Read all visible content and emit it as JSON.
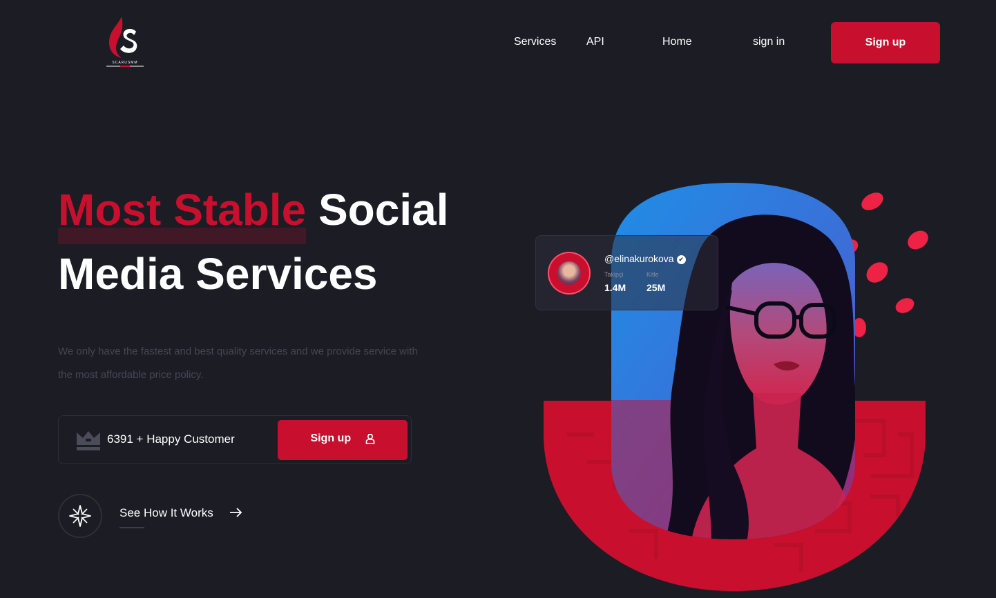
{
  "brand": {
    "logo_text": "SCARUSMM",
    "logo_icon": "flame-s-logo",
    "accent": "#c8102e",
    "background": "#1b1c24"
  },
  "nav": {
    "items": [
      {
        "label": "Services"
      },
      {
        "label": "API"
      },
      {
        "label": "Home"
      },
      {
        "label": "sign in"
      }
    ],
    "signup_label": "Sign up"
  },
  "hero": {
    "title_accent": "Most Stable",
    "title_rest": "Social",
    "title_line2": "Media Services",
    "description": "We only have the fastest and best quality services and we provide service with the most affordable price policy.",
    "customers": "6391 + Happy Customer",
    "cta_label": "Sign up",
    "how_label": "See How It Works"
  },
  "profile_card": {
    "handle": "@elinakurokova",
    "followers_label": "Takipçi",
    "followers_value": "1.4M",
    "audience_label": "Kitle",
    "audience_value": "25M"
  },
  "icons": [
    "crown-icon",
    "user-icon",
    "sparkle-icon",
    "arrow-right-icon",
    "verified-icon"
  ]
}
